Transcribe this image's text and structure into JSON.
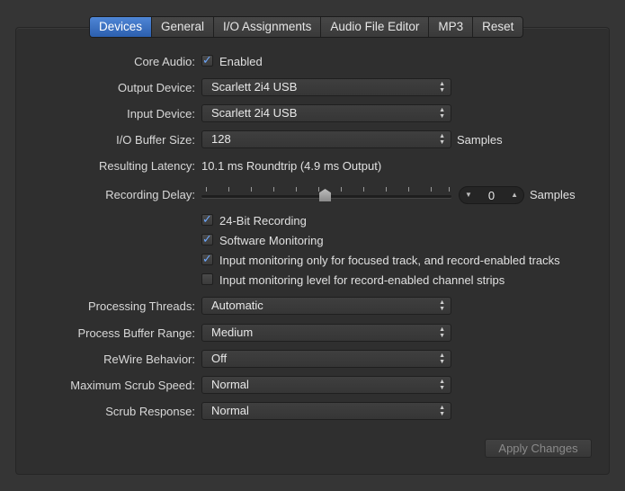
{
  "tabs": [
    "Devices",
    "General",
    "I/O Assignments",
    "Audio File Editor",
    "MP3",
    "Reset"
  ],
  "core_audio": {
    "label": "Core Audio:",
    "checkbox_label": "Enabled",
    "checked": true
  },
  "output_device": {
    "label": "Output Device:",
    "value": "Scarlett 2i4 USB"
  },
  "input_device": {
    "label": "Input Device:",
    "value": "Scarlett 2i4 USB"
  },
  "buffer": {
    "label": "I/O Buffer Size:",
    "value": "128",
    "unit": "Samples"
  },
  "latency": {
    "label": "Resulting Latency:",
    "value": "10.1 ms Roundtrip (4.9 ms Output)"
  },
  "recording_delay": {
    "label": "Recording Delay:",
    "value": "0",
    "unit": "Samples"
  },
  "options": [
    {
      "label": "24-Bit Recording",
      "checked": true
    },
    {
      "label": "Software Monitoring",
      "checked": true
    },
    {
      "label": "Input monitoring only for focused track, and record-enabled tracks",
      "checked": true
    },
    {
      "label": "Input monitoring level for record-enabled channel strips",
      "checked": false
    }
  ],
  "processing_threads": {
    "label": "Processing Threads:",
    "value": "Automatic"
  },
  "process_buffer": {
    "label": "Process Buffer Range:",
    "value": "Medium"
  },
  "rewire": {
    "label": "ReWire Behavior:",
    "value": "Off"
  },
  "scrub_speed": {
    "label": "Maximum Scrub Speed:",
    "value": "Normal"
  },
  "scrub_response": {
    "label": "Scrub Response:",
    "value": "Normal"
  },
  "apply_button": "Apply Changes",
  "icons": {
    "check": "✓",
    "arrows": "▲▼",
    "up": "▲",
    "down": "▼"
  }
}
